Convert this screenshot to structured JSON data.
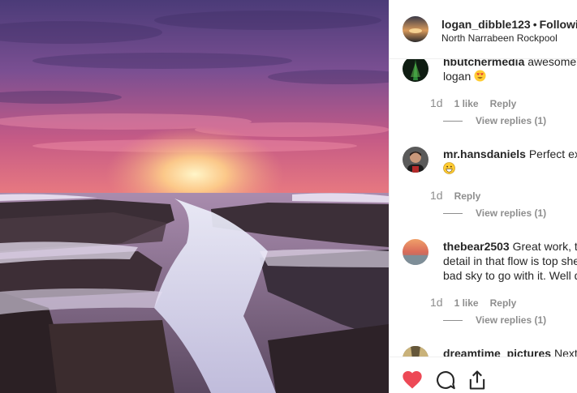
{
  "header": {
    "username": "logan_dibble123",
    "separator": "•",
    "follow_label": "Following",
    "location": "North Narrabeen Rockpool"
  },
  "comments": [
    {
      "username": "hbutchermedia",
      "line1": " awesome shot",
      "line2": "logan",
      "emoji": "heart-eyes-emoji",
      "age": "1d",
      "likes": "1 like",
      "reply_label": "Reply",
      "view_replies": "View replies (1)"
    },
    {
      "username": "mr.hansdaniels",
      "line1": " Perfect exposure",
      "emoji": "grinning-emoji",
      "age": "1d",
      "reply_label": "Reply",
      "view_replies": "View replies (1)"
    },
    {
      "username": "thebear2503",
      "line1": " Great work, the",
      "line2": "detail in that flow is top shelf",
      "line3": "bad sky to go with it. Well done",
      "age": "1d",
      "likes": "1 like",
      "reply_label": "Reply",
      "view_replies": "View replies (1)"
    },
    {
      "username": "dreamtime_pictures",
      "line1": " Next level"
    }
  ],
  "actions": {
    "like_icon": "heart-icon",
    "like_color": "#ed4956",
    "comment_icon": "comment-icon",
    "share_icon": "share-icon"
  }
}
